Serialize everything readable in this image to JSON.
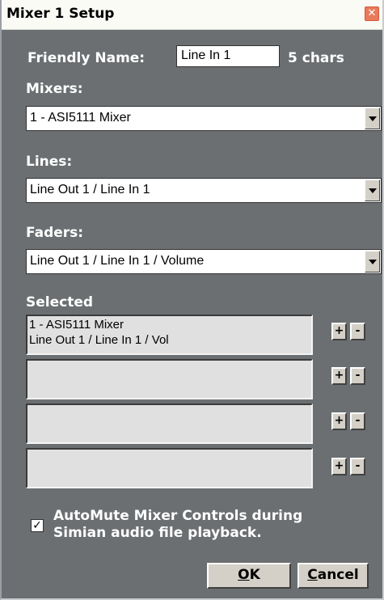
{
  "window": {
    "title": "Mixer 1 Setup"
  },
  "friendly_name": {
    "label": "Friendly Name:",
    "value": "Line In 1",
    "chars_label": "5 chars"
  },
  "mixers": {
    "label": "Mixers:",
    "selected": "1 - ASI5111 Mixer"
  },
  "lines": {
    "label": "Lines:",
    "selected": "Line Out 1 / Line In 1"
  },
  "faders": {
    "label": "Faders:",
    "selected": "Line Out 1 / Line In 1 / Volume"
  },
  "selected_section": {
    "label": "Selected",
    "slots": [
      {
        "line1": "1 - ASI5111 Mixer",
        "line2": "Line Out 1 / Line In 1 / Vol"
      },
      {
        "line1": "",
        "line2": ""
      },
      {
        "line1": "",
        "line2": ""
      },
      {
        "line1": "",
        "line2": ""
      }
    ],
    "plus_label": "+",
    "minus_label": "-"
  },
  "automute": {
    "checked": true,
    "line1": "AutoMute Mixer Controls during",
    "line2": "Simian audio file playback."
  },
  "buttons": {
    "ok_label": "OK",
    "ok_mnemonic": "O",
    "ok_rest": "K",
    "cancel_mnemonic": "C",
    "cancel_rest": "ancel"
  },
  "colors": {
    "dialog_bg": "#6b6f71",
    "titlebar_bg": "#fbfbf6",
    "close_btn": "#e97a5c"
  }
}
